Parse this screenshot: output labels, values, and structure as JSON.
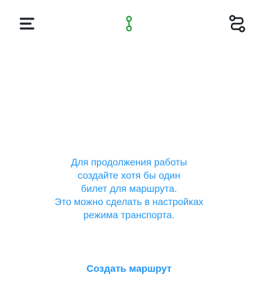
{
  "colors": {
    "accent": "#2196f3",
    "icon_dark": "#1f2328",
    "indicator": "#2ea043",
    "background": "#ffffff"
  },
  "header": {
    "left_icon": "menu-icon",
    "center_icon": "route-path-icon",
    "right_icon": "route-icon"
  },
  "empty_state": {
    "lines": [
      "Для продолжения работы",
      "создайте хотя бы один",
      "билет для маршрута.",
      "Это можно сделать в настройках",
      "режима транспорта."
    ]
  },
  "actions": {
    "create_route_label": "Создать маршрут"
  }
}
